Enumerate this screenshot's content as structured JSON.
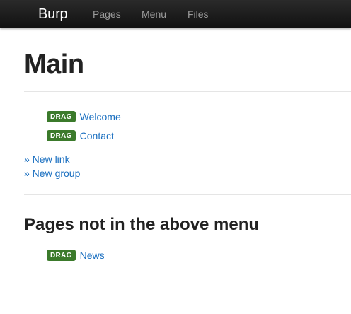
{
  "navbar": {
    "brand": "Burp",
    "links": [
      "Pages",
      "Menu",
      "Files"
    ]
  },
  "main": {
    "title": "Main",
    "menu_items": [
      {
        "badge": "DRAG",
        "label": "Welcome"
      },
      {
        "badge": "DRAG",
        "label": "Contact"
      }
    ],
    "new_link_label": "» New link",
    "new_group_label": "» New group"
  },
  "unlisted": {
    "title": "Pages not in the above menu",
    "items": [
      {
        "badge": "DRAG",
        "label": "News"
      }
    ]
  },
  "colors": {
    "navbar_bg": "#1b1b1b",
    "badge_bg": "#3b7a2b",
    "link": "#1a6fc0"
  }
}
